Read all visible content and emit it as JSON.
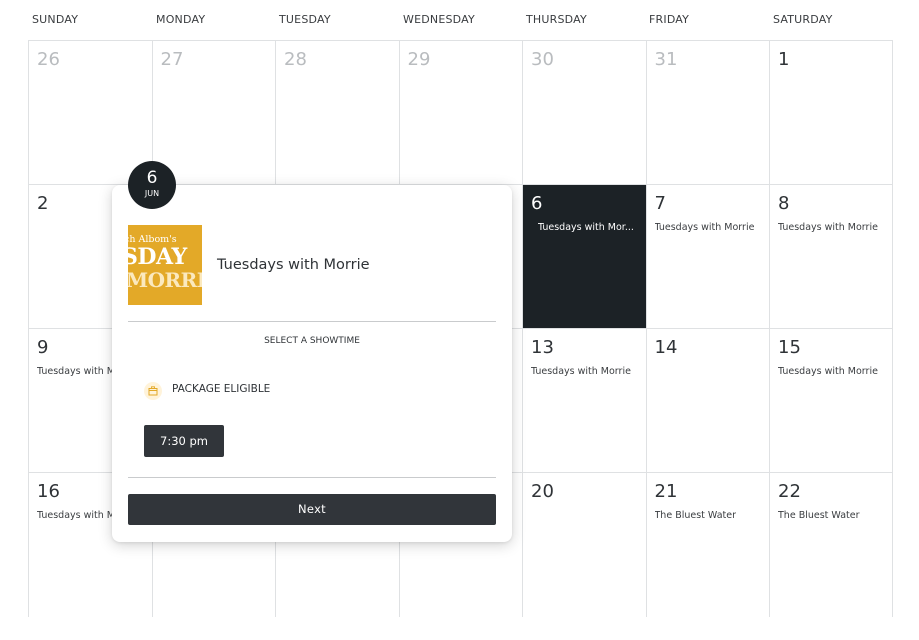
{
  "weekdays": [
    "SUNDAY",
    "MONDAY",
    "TUESDAY",
    "WEDNESDAY",
    "THURSDAY",
    "FRIDAY",
    "SATURDAY"
  ],
  "weeks": [
    [
      {
        "day": "26",
        "event": "",
        "dim": true
      },
      {
        "day": "27",
        "event": "",
        "dim": true
      },
      {
        "day": "28",
        "event": "",
        "dim": true
      },
      {
        "day": "29",
        "event": "",
        "dim": true
      },
      {
        "day": "30",
        "event": "",
        "dim": true
      },
      {
        "day": "31",
        "event": "",
        "dim": true
      },
      {
        "day": "1",
        "event": "",
        "dim": false
      }
    ],
    [
      {
        "day": "2",
        "event": "",
        "dim": false
      },
      {
        "day": "",
        "event": "",
        "dim": false
      },
      {
        "day": "",
        "event": "",
        "dim": false
      },
      {
        "day": "",
        "event": "",
        "dim": false
      },
      {
        "day": "6",
        "event": "Tuesdays with Mor...",
        "dim": false,
        "active": true
      },
      {
        "day": "7",
        "event": "Tuesdays with Morrie",
        "dim": false
      },
      {
        "day": "8",
        "event": "Tuesdays with Morrie",
        "dim": false
      }
    ],
    [
      {
        "day": "9",
        "event": "Tuesdays with M",
        "dim": false
      },
      {
        "day": "",
        "event": "",
        "dim": false
      },
      {
        "day": "",
        "event": "",
        "dim": false
      },
      {
        "day": "",
        "event": "",
        "dim": false
      },
      {
        "day": "13",
        "event": "Tuesdays with Morrie",
        "dim": false
      },
      {
        "day": "14",
        "event": "",
        "dim": false
      },
      {
        "day": "15",
        "event": "Tuesdays with Morrie",
        "dim": false
      }
    ],
    [
      {
        "day": "16",
        "event": "Tuesdays with M",
        "dim": false
      },
      {
        "day": "",
        "event": "",
        "dim": false
      },
      {
        "day": "",
        "event": "",
        "dim": false
      },
      {
        "day": "",
        "event": "",
        "dim": false
      },
      {
        "day": "20",
        "event": "",
        "dim": false
      },
      {
        "day": "21",
        "event": "The Bluest Water",
        "dim": false
      },
      {
        "day": "22",
        "event": "The Bluest Water",
        "dim": false
      }
    ]
  ],
  "popup": {
    "badge_day": "6",
    "badge_month": "JUN",
    "poster_line1": "ch Albom's",
    "poster_line2": "SDAY",
    "poster_line3": "MORRI",
    "show_title": "Tuesdays with Morrie",
    "select_label": "SELECT A SHOWTIME",
    "package_label": "PACKAGE ELIGIBLE",
    "package_icon": "package-icon",
    "time_label": "7:30 pm",
    "next_label": "Next"
  },
  "colors": {
    "accent_dark": "#1c2226",
    "button": "#31353a",
    "poster": "#e3a928"
  }
}
